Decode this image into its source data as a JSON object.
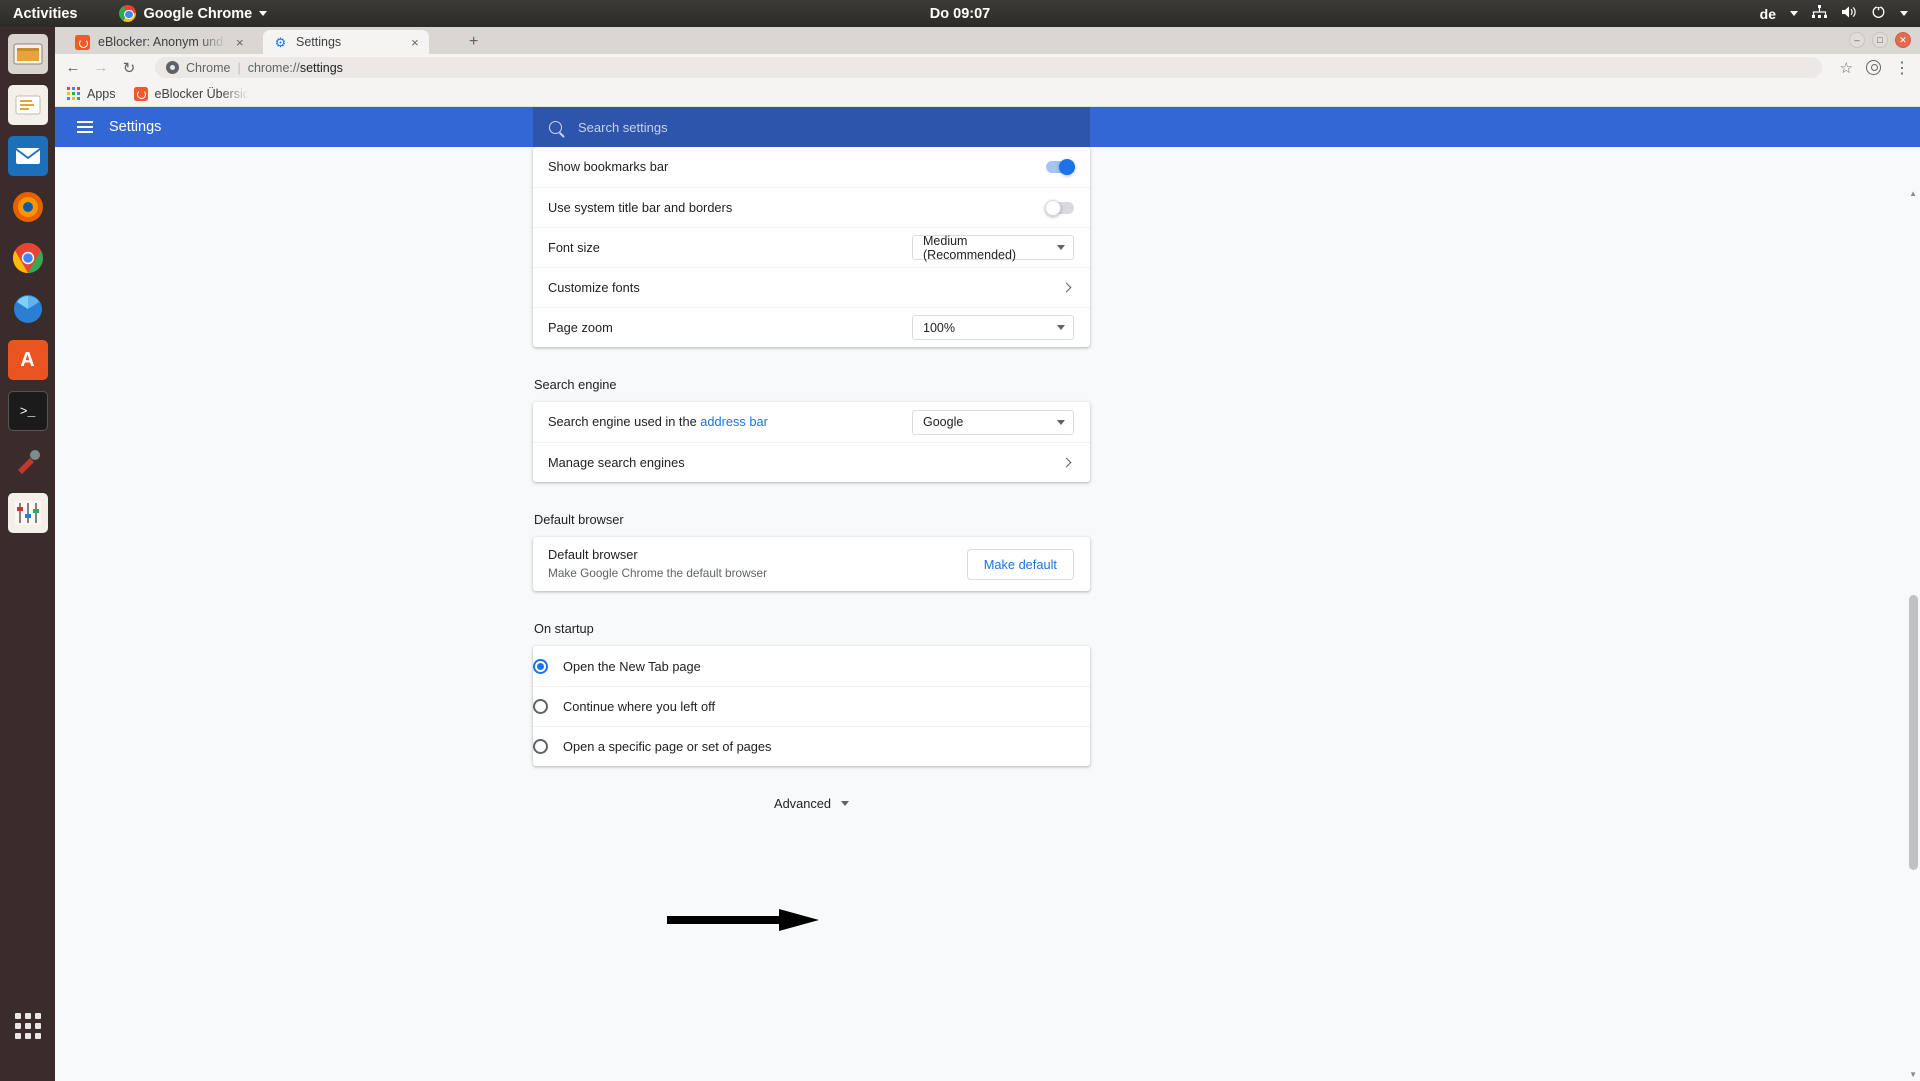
{
  "colors": {
    "accent": "#1a73e8",
    "settings_header": "#3367d6",
    "search_box": "#2c55ab",
    "page_bg": "#f8f9fa",
    "gnome_bar": "#3c3b37",
    "dock_bg": "#3b2c2c",
    "link": "#1a73e8",
    "eblocker_orange": "#f05a28"
  },
  "desktop": {
    "activities_label": "Activities",
    "app_menu_label": "Google Chrome",
    "clock": "Do 09:07",
    "keyboard_layout": "de",
    "tray_icons": [
      "network-icon",
      "volume-icon",
      "power-icon",
      "caret-down-icon"
    ],
    "dock_items": [
      {
        "name": "files-icon",
        "glyph": "🗄"
      },
      {
        "name": "text-editor-icon",
        "glyph": "✎"
      },
      {
        "name": "mail-icon",
        "glyph": "✉"
      },
      {
        "name": "firefox-icon",
        "glyph": "🦊"
      },
      {
        "name": "chrome-icon",
        "glyph": "◉"
      },
      {
        "name": "gimp-icon",
        "glyph": "❂"
      },
      {
        "name": "software-center-icon",
        "glyph": "A"
      },
      {
        "name": "terminal-icon",
        "glyph": ">_"
      },
      {
        "name": "settings-tools-icon",
        "glyph": "🔧"
      },
      {
        "name": "audio-mixer-icon",
        "glyph": "🎚"
      }
    ],
    "show_apps_label": "Show Applications"
  },
  "browser": {
    "tabs": [
      {
        "title": "eBlocker: Anonym und oh",
        "favicon": "eblocker-icon",
        "active": false,
        "close_label": "×"
      },
      {
        "title": "Settings",
        "favicon": "gear-icon",
        "active": true,
        "close_label": "×"
      }
    ],
    "new_tab_label": "+",
    "window_controls": {
      "minimize": "–",
      "maximize": "□",
      "close": "✕"
    },
    "toolbar": {
      "back_label": "←",
      "forward_label": "→",
      "reload_label": "↻",
      "star_label": "☆",
      "profile_label": "profile",
      "menu_label": "⋮"
    },
    "omnibox": {
      "scheme_label": "Chrome",
      "separator": "|",
      "url_prefix": "chrome://",
      "url_suffix": "settings"
    },
    "bookmarks": [
      {
        "label": "Apps",
        "icon": "apps-grid-icon"
      },
      {
        "label": "eBlocker Übersic",
        "icon": "eblocker-icon"
      }
    ]
  },
  "settings": {
    "header_title": "Settings",
    "menu_icon": "hamburger-icon",
    "search_placeholder": "Search settings",
    "search_value": "",
    "appearance_rows": [
      {
        "label": "Show bookmarks bar",
        "control": "toggle",
        "state": "on"
      },
      {
        "label": "Use system title bar and borders",
        "control": "toggle",
        "state": "off"
      },
      {
        "label": "Font size",
        "control": "select",
        "value": "Medium (Recommended)"
      },
      {
        "label": "Customize fonts",
        "control": "chevron"
      },
      {
        "label": "Page zoom",
        "control": "select",
        "value": "100%"
      }
    ],
    "search_engine": {
      "section_title": "Search engine",
      "row_label_prefix": "Search engine used in the ",
      "row_link": "address bar",
      "selected_engine": "Google",
      "manage_label": "Manage search engines"
    },
    "default_browser": {
      "section_title": "Default browser",
      "row_title": "Default browser",
      "row_sub": "Make Google Chrome the default browser",
      "button_label": "Make default"
    },
    "on_startup": {
      "section_title": "On startup",
      "options": [
        {
          "label": "Open the New Tab page",
          "selected": true
        },
        {
          "label": "Continue where you left off",
          "selected": false
        },
        {
          "label": "Open a specific page or set of pages",
          "selected": false
        }
      ]
    },
    "advanced": {
      "label": "Advanced",
      "caret_icon": "chevron-down-icon"
    },
    "annotation": {
      "type": "arrow",
      "points_to": "Advanced",
      "color": "#000000"
    }
  }
}
